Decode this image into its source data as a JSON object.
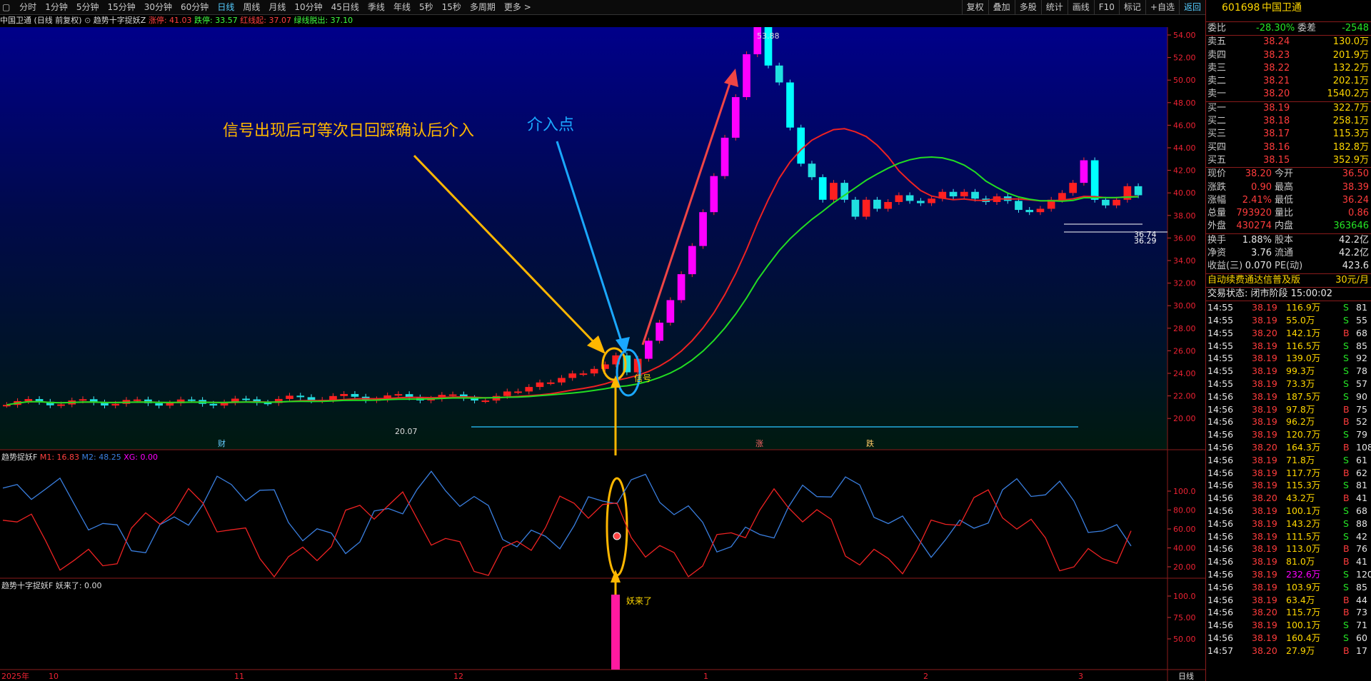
{
  "toolbar": {
    "periods": [
      "分时",
      "1分钟",
      "5分钟",
      "15分钟",
      "30分钟",
      "60分钟",
      "日线",
      "周线",
      "月线",
      "10分钟",
      "45日线",
      "季线",
      "年线",
      "5秒",
      "15秒",
      "多周期",
      "更多 >"
    ],
    "active_period": "日线",
    "right_tools": [
      "复权",
      "叠加",
      "多股",
      "统计",
      "画线",
      "F10",
      "标记",
      "+自选",
      "返回"
    ]
  },
  "chart": {
    "title": "中国卫通 (日线 前复权)",
    "indicator_name": "趋势十字捉妖Z",
    "zhangting_label": "涨停: 41.03",
    "dieting_label": "跌停: 33.57",
    "red_label": "红线起: 37.07",
    "green_label": "绿线脱出: 37.10",
    "annotation_main": "信号出现后可等次日回踩确认后介入",
    "annotation_entry": "介入点",
    "signal_label": "信号",
    "high_label": "53.88",
    "low_label": "20.07",
    "right_tag_1": "36.74",
    "right_tag_2": "36.29",
    "event_labels": [
      "财",
      "涨",
      "跌"
    ],
    "price_ticks": [
      "54.00",
      "52.00",
      "50.00",
      "48.00",
      "46.00",
      "44.00",
      "42.00",
      "40.00",
      "38.00",
      "36.00",
      "34.00",
      "32.00",
      "30.00",
      "28.00",
      "26.00",
      "24.00",
      "22.00",
      "20.00"
    ]
  },
  "sub1": {
    "title": "趋势捉妖F",
    "m1": "M1: 16.83",
    "m2": "M2: 48.25",
    "xg": "XG: 0.00",
    "ticks": [
      "100.0",
      "80.00",
      "60.00",
      "40.00",
      "20.00"
    ]
  },
  "sub2": {
    "title": "趋势十字捉妖F",
    "value": "妖来了: 0.00",
    "label": "妖来了",
    "ticks": [
      "100.0",
      "75.00",
      "50.00"
    ]
  },
  "bottom_axis": [
    "2025年",
    "10",
    "11",
    "12",
    "1",
    "2",
    "3"
  ],
  "bottom_right": "日线",
  "quote": {
    "code": "601698",
    "name": "中国卫通",
    "weibi_label": "委比",
    "weibi": "-28.30%",
    "weicha_label": "委差",
    "weicha": "-2548",
    "asks": [
      {
        "label": "卖五",
        "price": "38.24",
        "vol": "130.0万"
      },
      {
        "label": "卖四",
        "price": "38.23",
        "vol": "201.9万"
      },
      {
        "label": "卖三",
        "price": "38.22",
        "vol": "132.2万"
      },
      {
        "label": "卖二",
        "price": "38.21",
        "vol": "202.1万"
      },
      {
        "label": "卖一",
        "price": "38.20",
        "vol": "1540.2万"
      }
    ],
    "bids": [
      {
        "label": "买一",
        "price": "38.19",
        "vol": "322.7万"
      },
      {
        "label": "买二",
        "price": "38.18",
        "vol": "258.1万"
      },
      {
        "label": "买三",
        "price": "38.17",
        "vol": "115.3万"
      },
      {
        "label": "买四",
        "price": "38.16",
        "vol": "182.8万"
      },
      {
        "label": "买五",
        "price": "38.15",
        "vol": "352.9万"
      }
    ],
    "stats": [
      {
        "l1": "现价",
        "v1": "38.20",
        "l2": "今开",
        "v2": "36.50"
      },
      {
        "l1": "涨跌",
        "v1": "0.90",
        "l2": "最高",
        "v2": "38.39"
      },
      {
        "l1": "涨幅",
        "v1": "2.41%",
        "l2": "最低",
        "v2": "36.24"
      },
      {
        "l1": "总量",
        "v1": "793920",
        "l2": "量比",
        "v2": "0.86"
      },
      {
        "l1": "外盘",
        "v1": "430274",
        "l2": "内盘",
        "v2": "363646"
      }
    ],
    "stats2": [
      {
        "l1": "换手",
        "v1": "1.88%",
        "l2": "股本",
        "v2": "42.2亿"
      },
      {
        "l1": "净资",
        "v1": "3.76",
        "l2": "流通",
        "v2": "42.2亿"
      },
      {
        "l1": "收益(三)",
        "v1": "0.070",
        "l2": "PE(动)",
        "v2": "423.6"
      }
    ],
    "ad_text": "自动续费通达信普及版",
    "ad_price": "30元/月",
    "trade_status": "交易状态: 闭市阶段 15:00:02",
    "trades": [
      [
        "14:55",
        "38.19",
        "116.9万",
        "S",
        "81"
      ],
      [
        "14:55",
        "38.19",
        "55.0万",
        "S",
        "55"
      ],
      [
        "14:55",
        "38.20",
        "142.1万",
        "B",
        "68"
      ],
      [
        "14:55",
        "38.19",
        "116.5万",
        "S",
        "85"
      ],
      [
        "14:55",
        "38.19",
        "139.0万",
        "S",
        "92"
      ],
      [
        "14:55",
        "38.19",
        "99.3万",
        "S",
        "78"
      ],
      [
        "14:55",
        "38.19",
        "73.3万",
        "S",
        "57"
      ],
      [
        "14:56",
        "38.19",
        "187.5万",
        "S",
        "90"
      ],
      [
        "14:56",
        "38.19",
        "97.8万",
        "B",
        "75"
      ],
      [
        "14:56",
        "38.19",
        "96.2万",
        "B",
        "52"
      ],
      [
        "14:56",
        "38.19",
        "120.7万",
        "S",
        "79"
      ],
      [
        "14:56",
        "38.20",
        "164.3万",
        "B",
        "108"
      ],
      [
        "14:56",
        "38.19",
        "71.8万",
        "S",
        "61"
      ],
      [
        "14:56",
        "38.19",
        "117.7万",
        "B",
        "62"
      ],
      [
        "14:56",
        "38.19",
        "115.3万",
        "S",
        "81"
      ],
      [
        "14:56",
        "38.20",
        "43.2万",
        "B",
        "41"
      ],
      [
        "14:56",
        "38.19",
        "100.1万",
        "S",
        "68"
      ],
      [
        "14:56",
        "38.19",
        "143.2万",
        "S",
        "88"
      ],
      [
        "14:56",
        "38.19",
        "111.5万",
        "S",
        "42"
      ],
      [
        "14:56",
        "38.19",
        "113.0万",
        "B",
        "76"
      ],
      [
        "14:56",
        "38.19",
        "81.0万",
        "B",
        "41"
      ],
      [
        "14:56",
        "38.19",
        "232.6万",
        "S",
        "120"
      ],
      [
        "14:56",
        "38.19",
        "103.9万",
        "S",
        "85"
      ],
      [
        "14:56",
        "38.19",
        "63.4万",
        "B",
        "44"
      ],
      [
        "14:56",
        "38.20",
        "115.7万",
        "B",
        "73"
      ],
      [
        "14:56",
        "38.19",
        "100.1万",
        "S",
        "71"
      ],
      [
        "14:56",
        "38.19",
        "160.4万",
        "S",
        "60"
      ],
      [
        "14:57",
        "38.20",
        "27.9万",
        "B",
        "17"
      ]
    ]
  }
}
